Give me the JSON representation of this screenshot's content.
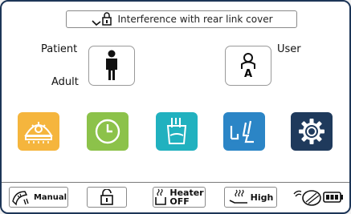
{
  "alert": {
    "message": "Interference with rear link cover",
    "icon": "seat-lock-icon"
  },
  "patient": {
    "label": "Patient",
    "mode": "Adult",
    "icon": "person-standing-icon"
  },
  "user": {
    "label": "User",
    "badge": "A",
    "icon": "user-a-icon"
  },
  "tiles": [
    {
      "name": "light",
      "icon": "dental-light-icon",
      "color": "#f5b53d"
    },
    {
      "name": "timer",
      "icon": "clock-icon",
      "color": "#8cc24a"
    },
    {
      "name": "cup-fill",
      "icon": "cup-fill-icon",
      "color": "#21b1bf"
    },
    {
      "name": "chair-position",
      "icon": "chair-position-icon",
      "color": "#2b85c6"
    },
    {
      "name": "settings",
      "icon": "gear-icon",
      "color": "#1f3a5c"
    }
  ],
  "bottom": {
    "manual_label": "Manual",
    "heater_title": "Heater",
    "heater_state": "OFF",
    "high_label": "High"
  }
}
